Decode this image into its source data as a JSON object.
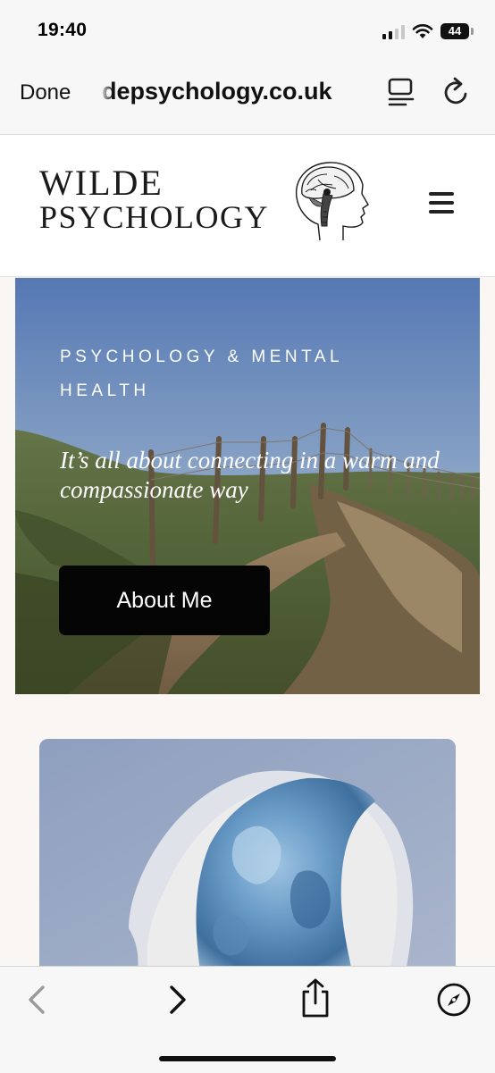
{
  "status_bar": {
    "time": "19:40",
    "battery": "44"
  },
  "browser": {
    "done_label": "Done",
    "url": "depsychology.co.uk"
  },
  "site": {
    "logo_line1": "WILDE",
    "logo_line2": "PSYCHOLOGY"
  },
  "hero": {
    "kicker": "PSYCHOLOGY & MENTAL HEALTH",
    "tagline": "It’s all about connecting in a warm and compassionate way",
    "button_label": "About Me"
  },
  "icons": {
    "signal": "cellular-signal-icon",
    "wifi": "wifi-icon",
    "battery": "battery-icon",
    "reader": "reader-mode-icon",
    "reload": "reload-icon",
    "menu": "hamburger-menu-icon",
    "back": "chevron-left-icon",
    "forward": "chevron-right-icon",
    "share": "share-icon",
    "safari": "compass-icon"
  },
  "colors": {
    "button": "#050505",
    "page_background": "#faf6f3",
    "card_background": "#9aa9c4"
  }
}
